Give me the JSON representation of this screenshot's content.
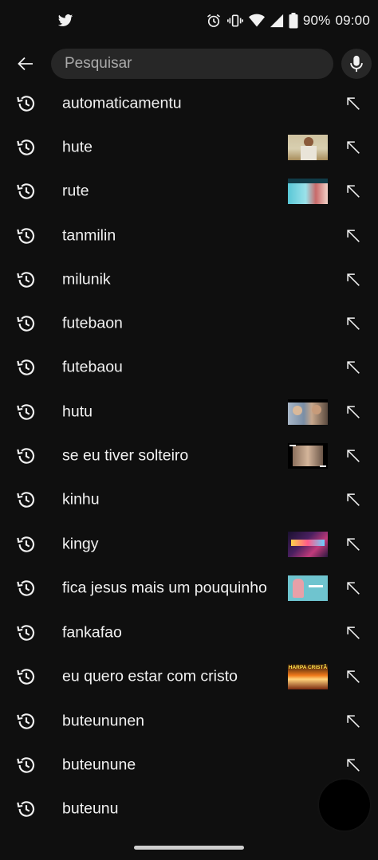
{
  "status_bar": {
    "battery_text": "90%",
    "time": "09:00"
  },
  "search": {
    "placeholder": "Pesquisar",
    "value": ""
  },
  "history": [
    {
      "text": "automaticamentu",
      "thumb": null
    },
    {
      "text": "hute",
      "thumb": "soccer"
    },
    {
      "text": "rute",
      "thumb": "video-cyan"
    },
    {
      "text": "tanmilin",
      "thumb": null
    },
    {
      "text": "milunik",
      "thumb": null
    },
    {
      "text": "futebaon",
      "thumb": null
    },
    {
      "text": "futebaou",
      "thumb": null
    },
    {
      "text": "hutu",
      "thumb": "people"
    },
    {
      "text": "se eu tiver solteiro",
      "thumb": "framed"
    },
    {
      "text": "kinhu",
      "thumb": null
    },
    {
      "text": "kingy",
      "thumb": "game"
    },
    {
      "text": "fica jesus mais um pouquinho",
      "thumb": "teal"
    },
    {
      "text": "fankafao",
      "thumb": null
    },
    {
      "text": "eu quero estar com cristo",
      "thumb": "harpa",
      "thumb_text": "HARPA CRISTÃ"
    },
    {
      "text": "buteununen",
      "thumb": null
    },
    {
      "text": "buteunune",
      "thumb": null
    },
    {
      "text": "buteunu",
      "thumb": null
    }
  ],
  "colors": {
    "background": "#0f0f0f",
    "search_bg": "#272727",
    "text": "#f1f1f1",
    "placeholder": "#aaaaaa"
  }
}
